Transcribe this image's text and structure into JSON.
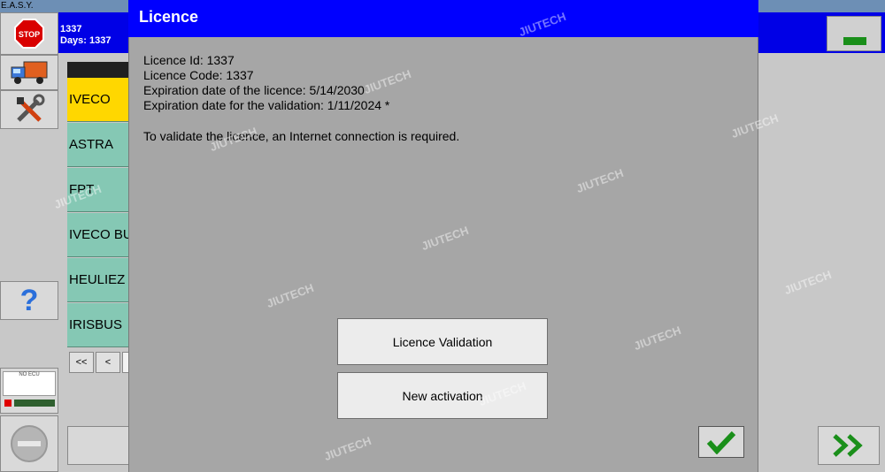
{
  "app": {
    "title": "E.A.S.Y."
  },
  "header": {
    "line1": "1337",
    "line2": "Days: 1337"
  },
  "toolbar": {
    "stop_label": "STOP",
    "help_label": "?"
  },
  "ecu": {
    "label": "NO ECU"
  },
  "brands": [
    {
      "label": "IVECO",
      "selected": true
    },
    {
      "label": "ASTRA",
      "selected": false
    },
    {
      "label": "FPT",
      "selected": false
    },
    {
      "label": "IVECO BUS",
      "selected": false
    },
    {
      "label": "HEULIEZ BUS",
      "selected": false
    },
    {
      "label": "IRISBUS",
      "selected": false
    }
  ],
  "pager": {
    "first": "<<",
    "prev": "<"
  },
  "dialog": {
    "title": "Licence",
    "licence_id": "Licence Id: 1337",
    "licence_code": "Licence Code: 1337",
    "expiration_licence": "Expiration date of the licence: 5/14/2030",
    "expiration_validation": "Expiration date for the validation: 1/11/2024 *",
    "note": "To validate the licence, an Internet connection is required.",
    "validate_button": "Licence Validation",
    "activation_button": "New activation"
  },
  "watermark": "JIUTECH",
  "colors": {
    "header_blue": "#0000e6",
    "dialog_blue": "#0000ff",
    "dialog_bg": "#a6a6a6",
    "selected": "#ffd700",
    "brand_bg": "#85c8b4",
    "ok_green": "#1a8f1a"
  }
}
